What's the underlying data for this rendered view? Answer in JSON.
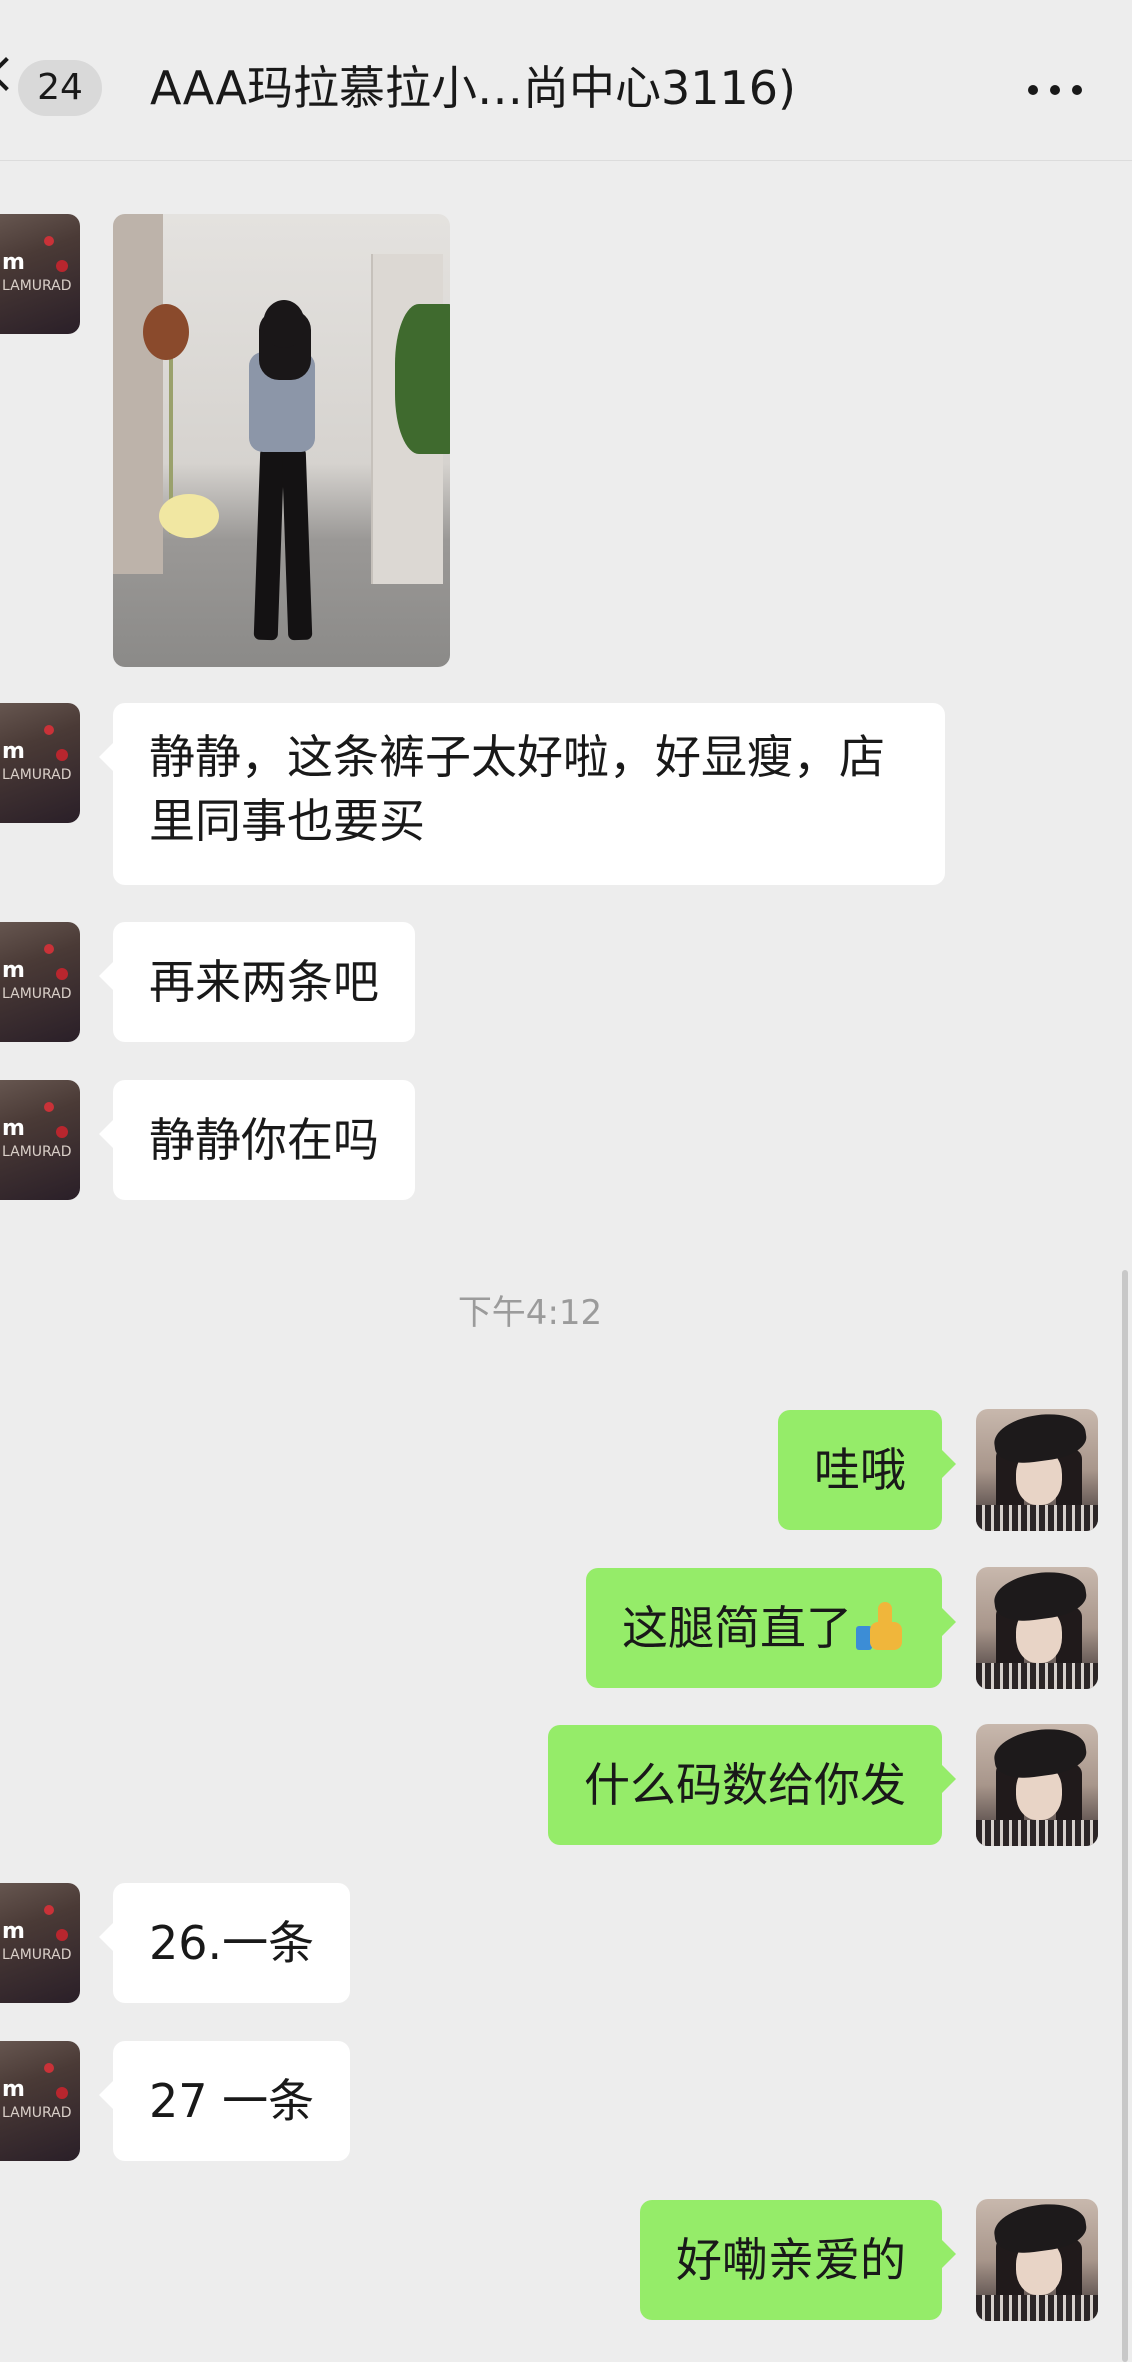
{
  "header": {
    "unread_count": "24",
    "title": "AAA玛拉慕拉小…尚中心3116)"
  },
  "timestamp": "下午4:12",
  "avatars": {
    "left_logo": "m",
    "left_brand": "LAMURAD"
  },
  "messages": [
    {
      "side": "left",
      "type": "image"
    },
    {
      "side": "left",
      "text": "静静，这条裤子太好啦，好显瘦，店里同事也要买"
    },
    {
      "side": "left",
      "text": "再来两条吧"
    },
    {
      "side": "left",
      "text": "静静你在吗"
    },
    {
      "side": "right",
      "text": "哇哦"
    },
    {
      "side": "right",
      "text": "这腿简直了",
      "emoji": "thumbs-up"
    },
    {
      "side": "right",
      "text": "什么码数给你发"
    },
    {
      "side": "left",
      "text": "26.一条"
    },
    {
      "side": "left",
      "text": "27 一条"
    },
    {
      "side": "right",
      "text": "好嘞亲爱的"
    }
  ],
  "colors": {
    "background": "#ededed",
    "bubble_left": "#ffffff",
    "bubble_right": "#95ec69"
  }
}
